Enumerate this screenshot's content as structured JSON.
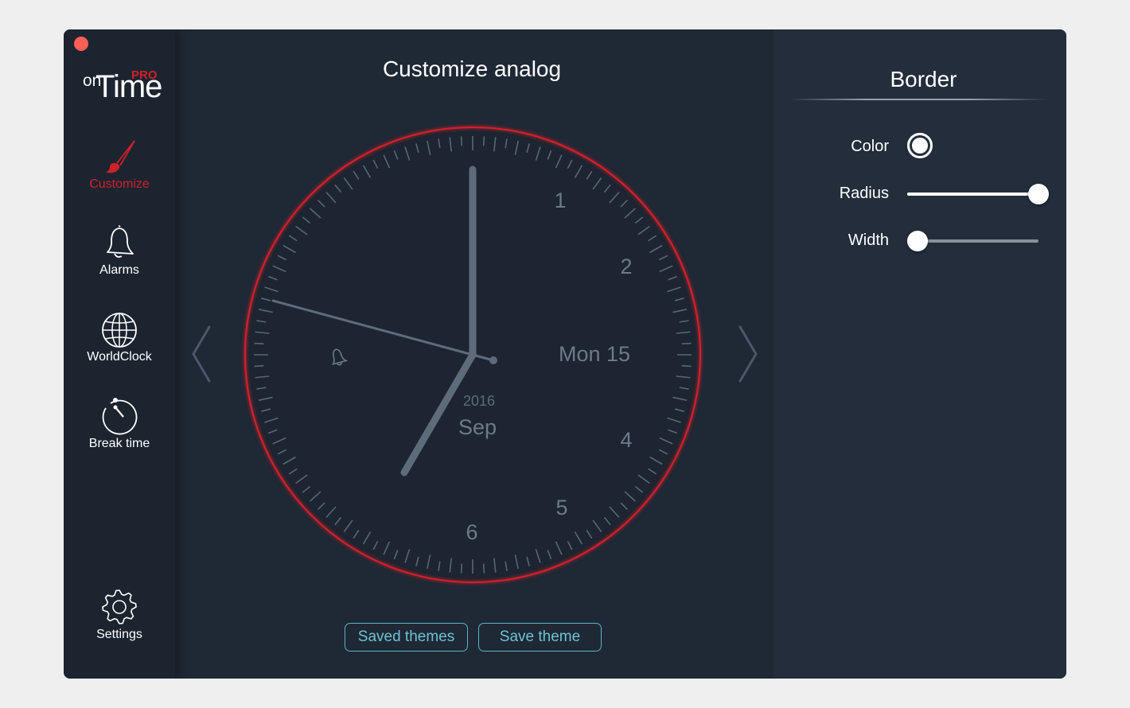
{
  "app": {
    "logo_on": "on",
    "logo_time": "Time",
    "logo_pro": "PRO"
  },
  "sidebar": {
    "items": [
      {
        "label": "Customize",
        "icon": "paintbrush-icon",
        "active": true
      },
      {
        "label": "Alarms",
        "icon": "bell-icon",
        "active": false
      },
      {
        "label": "WorldClock",
        "icon": "globe-icon",
        "active": false
      },
      {
        "label": "Break time",
        "icon": "stopwatch-icon",
        "active": false
      }
    ],
    "settings_label": "Settings"
  },
  "main": {
    "title": "Customize analog",
    "clock": {
      "hour_numerals": [
        "1",
        "2",
        "4",
        "5",
        "6"
      ],
      "date_label": "Mon 15",
      "year": "2016",
      "month": "Sep",
      "alarm_icon": "alarm-bell-icon",
      "border_color": "#d0202a"
    },
    "buttons": {
      "saved_themes": "Saved themes",
      "save_theme": "Save theme"
    }
  },
  "panel": {
    "title": "Border",
    "color_label": "Color",
    "color_value": "#ffffff",
    "radius_label": "Radius",
    "radius_value": 1.0,
    "width_label": "Width",
    "width_value": 0.08
  },
  "colors": {
    "accent": "#d0202a",
    "button_text": "#6cc3d5",
    "hand": "#5e6b7b"
  }
}
